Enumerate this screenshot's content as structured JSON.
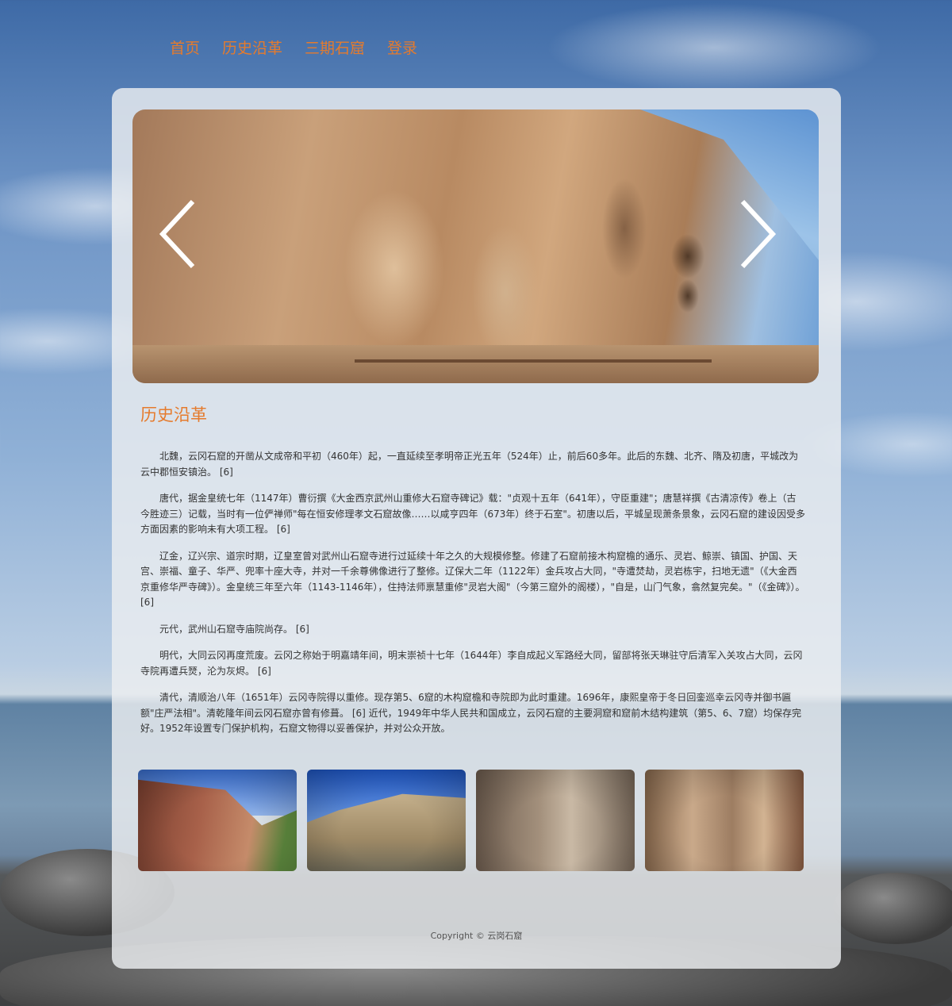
{
  "nav": {
    "items": [
      {
        "label": "首页"
      },
      {
        "label": "历史沿革"
      },
      {
        "label": "三期石窟"
      },
      {
        "label": "登录"
      }
    ]
  },
  "carousel": {
    "prev_icon": "chevron-left-icon",
    "next_icon": "chevron-right-icon"
  },
  "section": {
    "title": "历史沿革"
  },
  "article": {
    "paragraphs": [
      "北魏，云冈石窟的开凿从文成帝和平初（460年）起，一直延续至孝明帝正光五年（524年）止，前后60多年。此后的东魏、北齐、隋及初唐，平城改为云中郡恒安镇治。 [6]",
      "唐代，据金皇统七年（1147年）曹衍撰《大金西京武州山重修大石窟寺碑记》载：\"贞观十五年（641年），守臣重建\"；唐慧祥撰《古清凉传》卷上（古今胜迹三）记载，当时有一位俨禅师\"每在恒安修理孝文石窟故像……以咸亨四年（673年）终于石室\"。初唐以后，平城呈现萧条景象，云冈石窟的建设因受多方面因素的影响未有大项工程。 [6]",
      "辽金，辽兴宗、道宗时期，辽皇室曾对武州山石窟寺进行过延续十年之久的大规模修整。修建了石窟前接木构窟檐的通乐、灵岩、鲸崇、镇国、护国、天宫、崇福、童子、华严、兜率十座大寺，并对一千余尊佛像进行了整修。辽保大二年（1122年）金兵攻占大同，\"寺遭焚劫，灵岩栋宇，扫地无遗\"（《大金西京重修华严寺碑》）。金皇统三年至六年（1143-1146年），住持法师禀慧重修\"灵岩大阁\"（今第三窟外的阁楼），\"自是，山门气象，翕然复完矣。\"（《金碑》）。 [6]",
      "元代，武州山石窟寺庙院尚存。 [6]",
      "明代，大同云冈再度荒废。云冈之称始于明嘉靖年间，明末崇祯十七年（1644年）李自成起义军路经大同，留部将张天琳驻守后清军入关攻占大同，云冈寺院再遭兵燹，沦为灰烬。 [6]",
      "清代，清顺治八年（1651年）云冈寺院得以重修。现存第5、6窟的木构窟檐和寺院即为此时重建。1696年，康熙皇帝于冬日回銮巡幸云冈寺并御书匾额\"庄严法相\"。清乾隆年间云冈石窟亦曾有修葺。 [6] 近代，1949年中华人民共和国成立，云冈石窟的主要洞窟和窟前木结构建筑（第5、6、7窟）均保存完好。1952年设置专门保护机构，石窟文物得以妥善保护，并对公众开放。"
    ]
  },
  "footer": {
    "copyright": "Copyright © 云岗石窟"
  },
  "colors": {
    "accent": "#e57b2d"
  }
}
